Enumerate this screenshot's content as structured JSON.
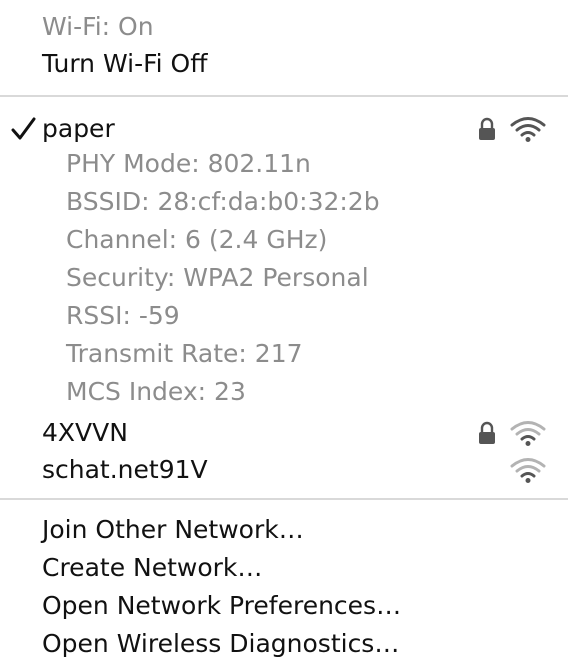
{
  "status": {
    "wifi_state": "Wi-Fi: On",
    "toggle_label": "Turn Wi-Fi Off"
  },
  "current_network": {
    "name": "paper",
    "details": [
      "PHY Mode: 802.11n",
      "BSSID: 28:cf:da:b0:32:2b",
      "Channel: 6 (2.4 GHz)",
      "Security: WPA2 Personal",
      "RSSI: -59",
      "Transmit Rate: 217",
      "MCS Index: 23"
    ],
    "icons": [
      "checkmark-icon",
      "lock-icon",
      "wifi-signal-icon"
    ]
  },
  "networks": [
    {
      "name": "4XVVN",
      "secured": true,
      "icons": [
        "lock-icon",
        "wifi-signal-icon"
      ]
    },
    {
      "name": "schat.net91V",
      "secured": false,
      "icons": [
        "wifi-signal-icon"
      ]
    }
  ],
  "actions": [
    "Join Other Network…",
    "Create Network…",
    "Open Network Preferences…",
    "Open Wireless Diagnostics…"
  ],
  "colors": {
    "text": "#111111",
    "dim_text": "#8c8c8c",
    "separator": "#d9d9d9",
    "icon_dark": "#555555",
    "icon_light": "#b3b3b3"
  }
}
